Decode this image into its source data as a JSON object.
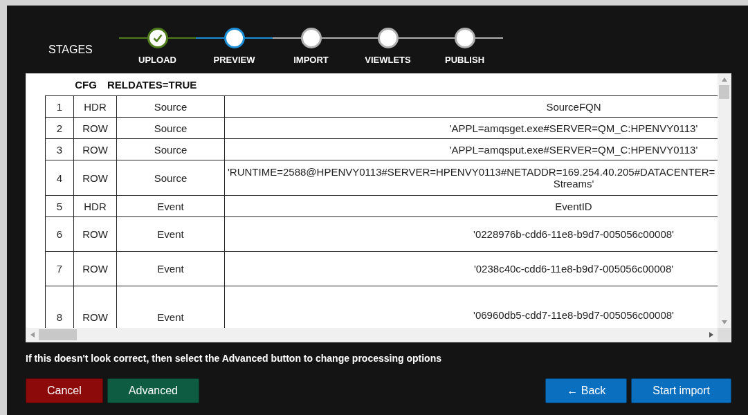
{
  "stages": {
    "label": "STAGES",
    "steps": [
      {
        "label": "UPLOAD",
        "completed": true,
        "selected": false
      },
      {
        "label": "PREVIEW",
        "completed": false,
        "selected": true
      },
      {
        "label": "IMPORT",
        "completed": false,
        "selected": false
      },
      {
        "label": "VIEWLETS",
        "completed": false,
        "selected": false
      },
      {
        "label": "PUBLISH",
        "completed": false,
        "selected": false
      }
    ]
  },
  "preview": {
    "config": {
      "key": "CFG",
      "value": "RELDATES=TRUE"
    },
    "rows": [
      {
        "num": "1",
        "type": "HDR",
        "entity": "Source",
        "value": [
          "SourceFQN"
        ]
      },
      {
        "num": "2",
        "type": "ROW",
        "entity": "Source",
        "value": [
          "'APPL=amqsget.exe#SERVER=QM_C:HPENVY0113'"
        ]
      },
      {
        "num": "3",
        "type": "ROW",
        "entity": "Source",
        "value": [
          "'APPL=amqsput.exe#SERVER=QM_C:HPENVY0113'"
        ]
      },
      {
        "num": "4",
        "type": "ROW",
        "entity": "Source",
        "value": [
          "'RUNTIME=2588@HPENVY0113#SERVER=HPENVY0113#NETADDR=169.254.40.205#DATACENTER=",
          "Streams'"
        ]
      },
      {
        "num": "5",
        "type": "HDR",
        "entity": "Event",
        "value": [
          "EventID"
        ]
      },
      {
        "num": "6",
        "type": "ROW",
        "entity": "Event",
        "value": [
          "'0228976b-cdd6-11e8-b9d7-005056c00008'"
        ]
      },
      {
        "num": "7",
        "type": "ROW",
        "entity": "Event",
        "value": [
          "'0238c40c-cdd6-11e8-b9d7-005056c00008'"
        ]
      },
      {
        "num": "8",
        "type": "ROW",
        "entity": "Event",
        "value": [
          "'06960db5-cdd7-11e8-b9d7-005056c00008'"
        ]
      }
    ]
  },
  "message": "If this doesn't look correct, then select the Advanced button to change processing options",
  "buttons": {
    "left": [
      {
        "label": "Cancel",
        "kind": "danger"
      },
      {
        "label": "Advanced",
        "kind": "secondary"
      }
    ],
    "right": [
      {
        "label": "← Back",
        "kind": "primary"
      },
      {
        "label": "Start import",
        "kind": "primary"
      }
    ]
  }
}
